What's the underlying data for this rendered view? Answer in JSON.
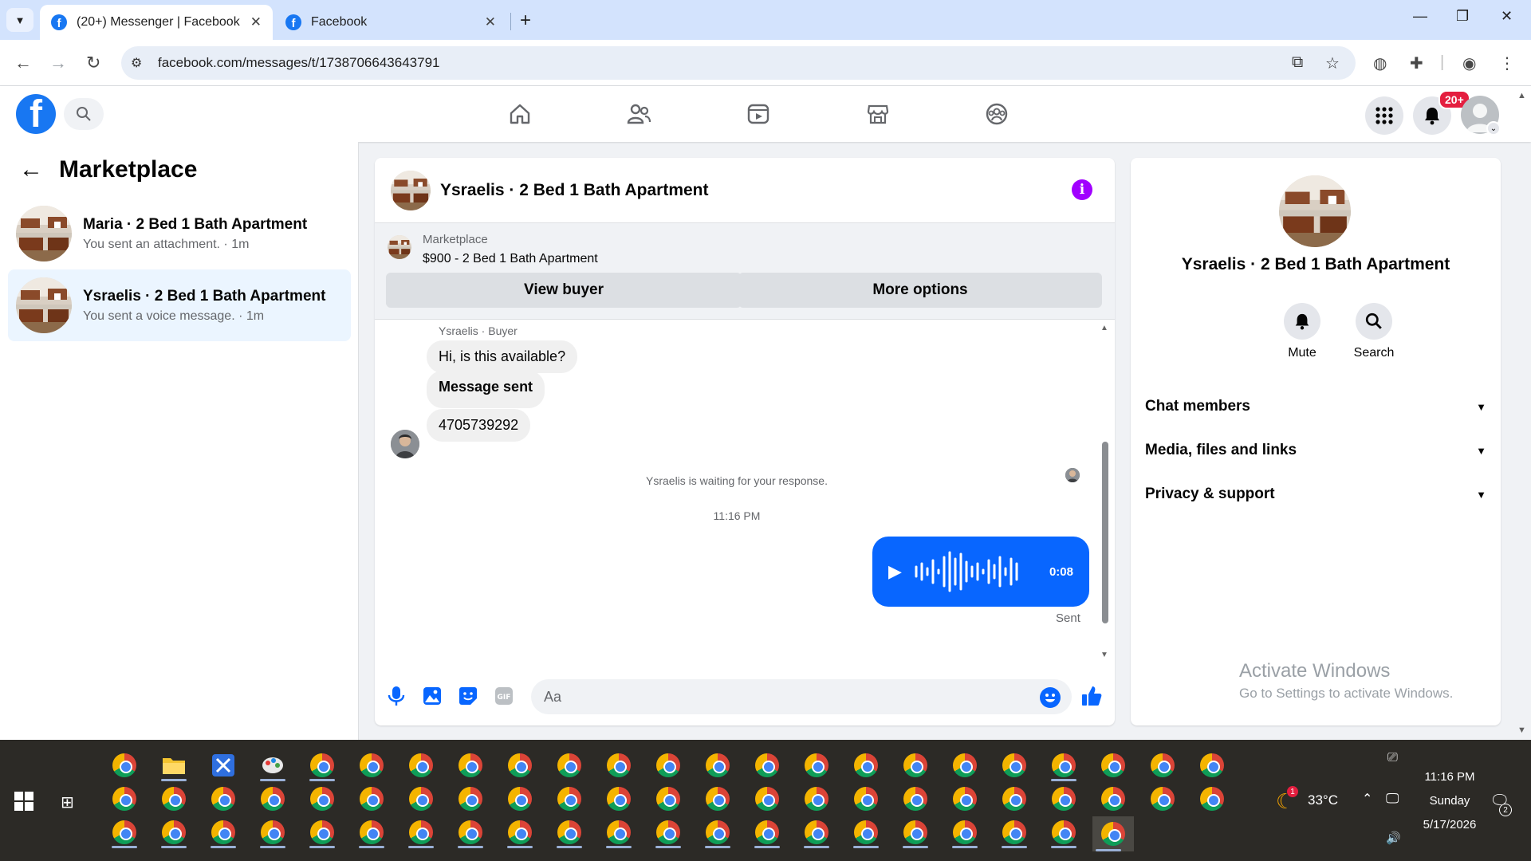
{
  "browser": {
    "tabs": [
      {
        "title": "(20+) Messenger | Facebook",
        "active": true
      },
      {
        "title": "Facebook",
        "active": false
      }
    ],
    "url": "facebook.com/messages/t/1738706643643791"
  },
  "fbnav": {
    "notification_badge": "20+"
  },
  "sidebar": {
    "title": "Marketplace",
    "conversations": [
      {
        "name": "Maria · 2 Bed 1 Bath Apartment",
        "preview": "You sent an attachment. · 1m",
        "active": false
      },
      {
        "name": "Ysraelis · 2 Bed 1 Bath Apartment",
        "preview": "You sent a voice message. · 1m",
        "active": true
      }
    ]
  },
  "chat": {
    "title": "Ysraelis · 2 Bed 1 Bath Apartment",
    "listing": {
      "label": "Marketplace",
      "price_title": "$900 - 2 Bed 1 Bath Apartment",
      "view_buyer": "View buyer",
      "more_options": "More options"
    },
    "sender_label": "Ysraelis · Buyer",
    "messages_in": [
      "Hi, is this available?",
      "Message sent",
      "4705739292"
    ],
    "waiting_text": "Ysraelis is waiting for your response.",
    "timestamp": "11:16 PM",
    "voice_duration": "0:08",
    "sent_status": "Sent",
    "input_placeholder": "Aa"
  },
  "right_panel": {
    "name": "Ysraelis · 2 Bed 1 Bath Apartment",
    "actions": [
      {
        "label": "Mute"
      },
      {
        "label": "Search"
      }
    ],
    "sections": [
      "Chat members",
      "Media, files and links",
      "Privacy & support"
    ]
  },
  "watermark": {
    "line1": "Activate Windows",
    "line2": "Go to Settings to activate Windows."
  },
  "taskbar": {
    "weather_temp": "33°C",
    "weather_alert": "1",
    "time": "11:16 PM",
    "day": "Sunday",
    "date": "5/17/2026",
    "notification_count": "2"
  },
  "colors": {
    "fb_blue": "#1877f2",
    "messenger_blue": "#0866ff",
    "info_purple": "#a100ff",
    "badge_red": "#e41e3f"
  }
}
